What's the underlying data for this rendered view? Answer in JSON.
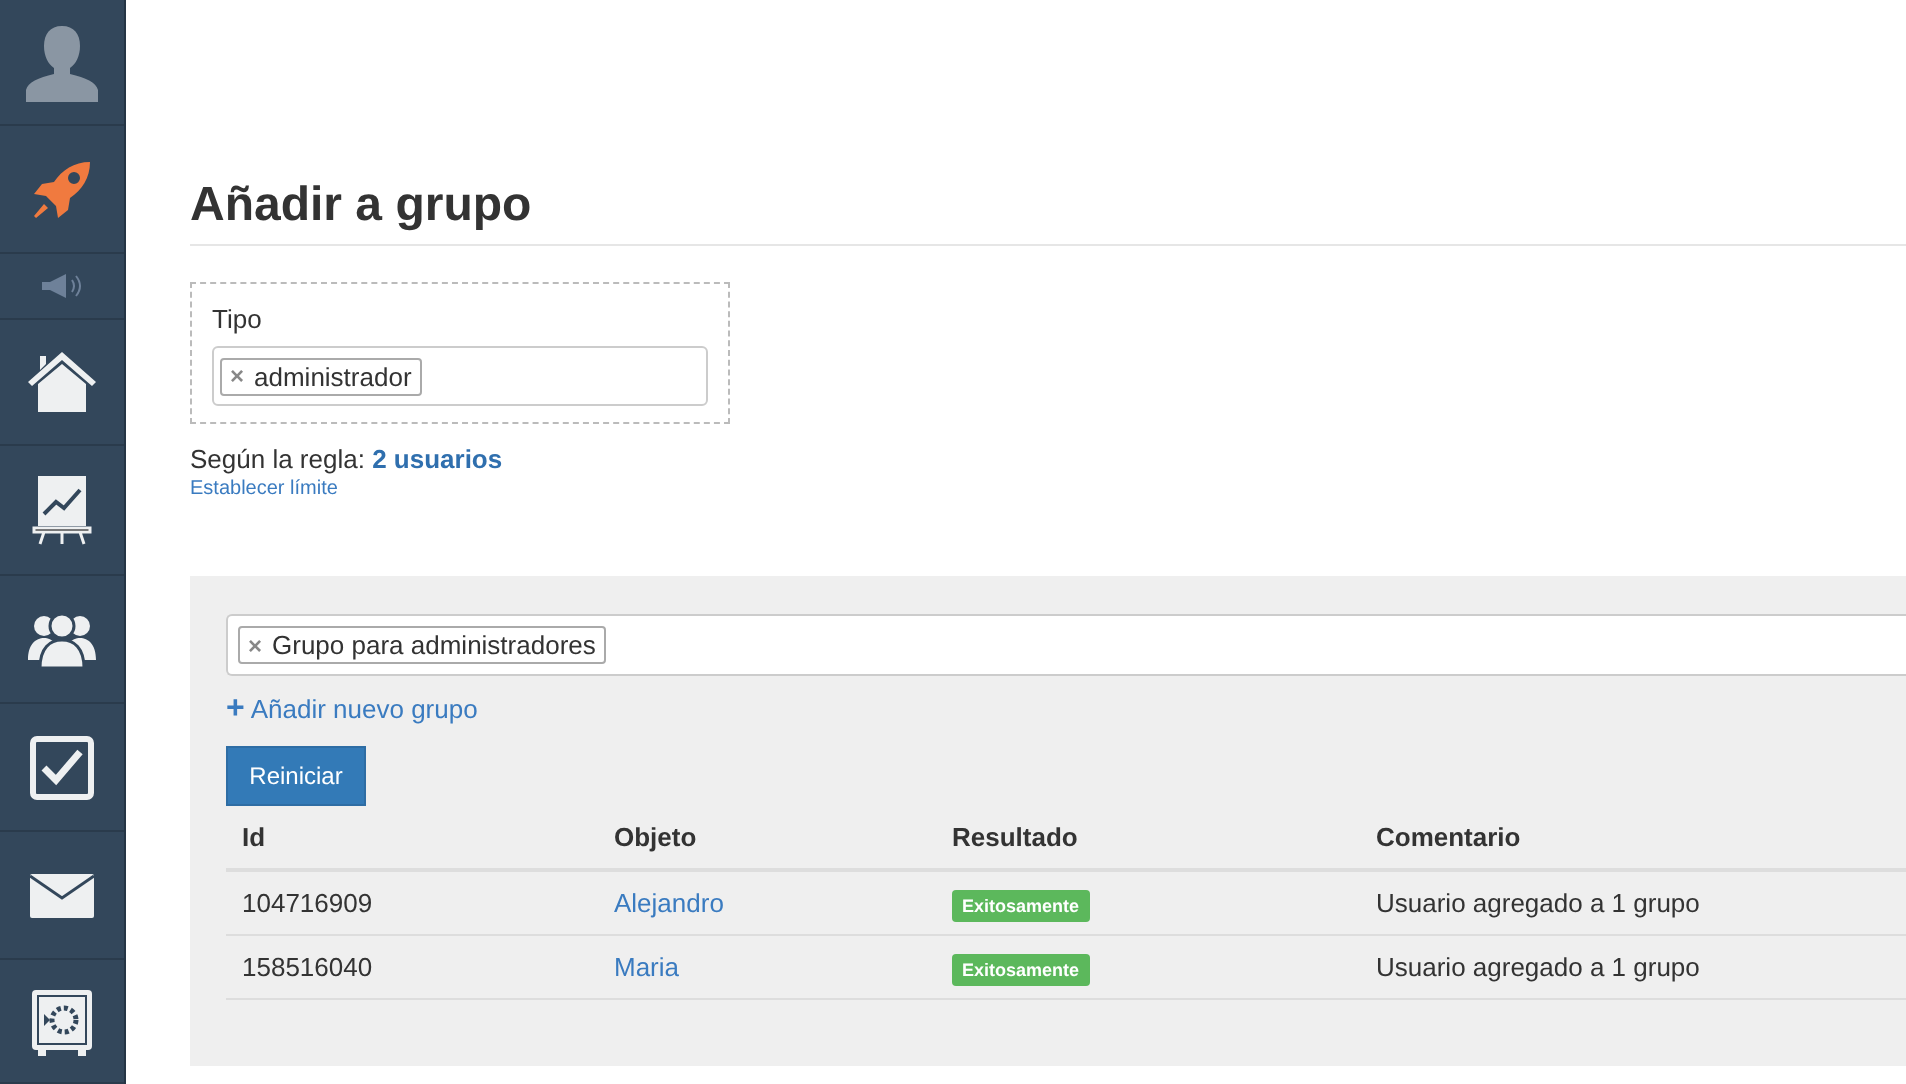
{
  "title": "Añadir a grupo",
  "type_field": {
    "label": "Tipo",
    "tags": [
      {
        "remove": "×",
        "label": "administrador"
      }
    ]
  },
  "rule": {
    "prefix": "Según la regla:",
    "count": "2 usuarios",
    "limit_link": "Establecer límite"
  },
  "group_field": {
    "tags": [
      {
        "remove": "×",
        "label": "Grupo para administradores"
      }
    ]
  },
  "add_group": {
    "icon": "+",
    "label": "Añadir nuevo grupo"
  },
  "reset_button": "Reiniciar",
  "table": {
    "columns": [
      "Id",
      "Objeto",
      "Resultado",
      "Comentario"
    ],
    "rows": [
      {
        "id": "104716909",
        "object": "Alejandro",
        "result": "Exitosamente",
        "comment": "Usuario agregado a 1 grupo"
      },
      {
        "id": "158516040",
        "object": "Maria",
        "result": "Exitosamente",
        "comment": "Usuario agregado a 1 grupo"
      }
    ]
  }
}
